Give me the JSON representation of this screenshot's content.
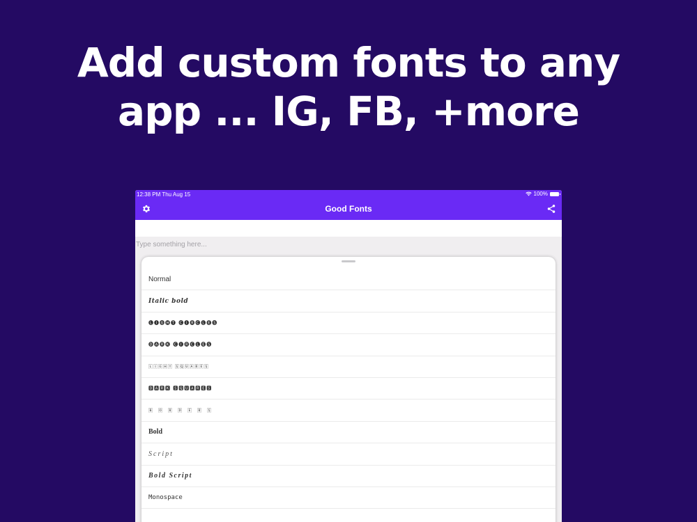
{
  "headline": {
    "line1": "Add custom fonts to any",
    "line2": "app ... IG, FB, +more"
  },
  "status_bar": {
    "time": "12:38 PM  Thu Aug 15",
    "battery": "100%"
  },
  "app_bar": {
    "title": "Good Fonts",
    "left_icon": "gear-icon",
    "right_icon": "share-icon",
    "color": "#6a2af5"
  },
  "input": {
    "placeholder": "Type something here..."
  },
  "font_styles": [
    "Normal",
    "Italic bold",
    "🅛🅘🅖🅗🅣 🅒🅘🅡🅒🅛🅔🅢",
    "🅓🅐🅡🅚 🅒🅘🅡🅒🅛🅔🅢",
    "🄻🄸🄶🄷🅃 🅂🅀🅄🄰🅁🄴🅂",
    "🅳🅰🆁🅺 🆂🆀🆄🅰🆁🅴🆂",
    "🄱🄾🅁🄳🄴🅁🅂",
    "Bold",
    "Script",
    "Bold Script",
    "Monospace"
  ],
  "colors": {
    "background": "#240a63",
    "accent": "#6a2af5"
  }
}
